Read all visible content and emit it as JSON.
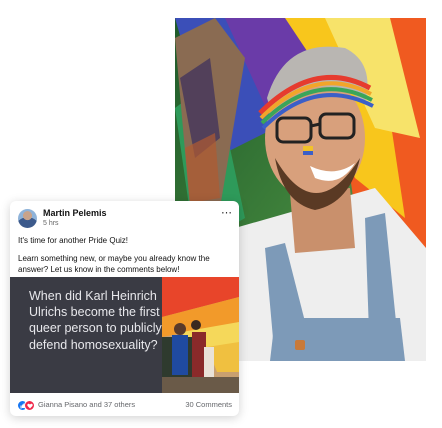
{
  "post": {
    "author": "Martin Pelemis",
    "time": "5 hrs",
    "more_icon": "⋯",
    "text_line1": "It's time for another Pride Quiz!",
    "text_line2": "Learn something new, or maybe you already know the answer? Let us know in the comments below!",
    "quiz_question": "When did Karl Heinrich Ulrichs become the first queer person to publicly defend homosexuality?",
    "reactions_text": "Gianna Pisano and 37 others",
    "comments_text": "30 Comments"
  },
  "icons": {
    "like": "like-reaction-icon",
    "love": "love-reaction-icon",
    "more": "more-options-icon"
  },
  "colors": {
    "quiz_bg": "#3a3b44",
    "like_blue": "#1877f2",
    "love_red": "#f0284a"
  }
}
